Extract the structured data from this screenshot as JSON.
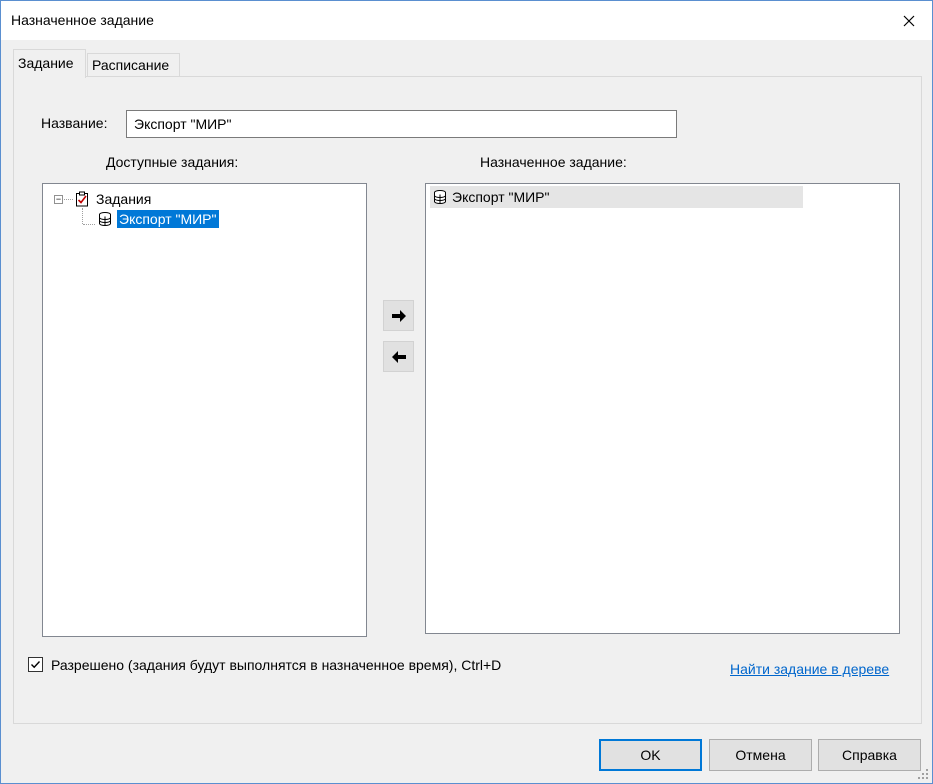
{
  "window": {
    "title": "Назначенное задание"
  },
  "tabs": [
    {
      "label": "Задание",
      "active": true
    },
    {
      "label": "Расписание",
      "active": false
    }
  ],
  "form": {
    "name_label": "Название:",
    "name_value": "Экспорт \"МИР\""
  },
  "available": {
    "header": "Доступные задания:",
    "tree": {
      "root_label": "Задания",
      "child_label": "Экспорт \"МИР\""
    }
  },
  "assigned": {
    "header": "Назначенное задание:",
    "item_label": "Экспорт \"МИР\""
  },
  "options": {
    "enabled_label": "Разрешено (задания будут выполнятся в назначенное время), Ctrl+D",
    "enabled_checked": true,
    "find_link": "Найти задание в дереве"
  },
  "buttons": {
    "ok": "OK",
    "cancel": "Отмена",
    "help": "Справка"
  },
  "colors": {
    "selection": "#0078d7",
    "link": "#0066cc",
    "default_button_border": "#0078d7"
  },
  "icons": {
    "close": "close-icon",
    "tasks_root": "checklist-icon",
    "task_item": "database-icon",
    "move_right": "arrow-right-icon",
    "move_left": "arrow-left-icon",
    "check": "checkmark-icon"
  }
}
